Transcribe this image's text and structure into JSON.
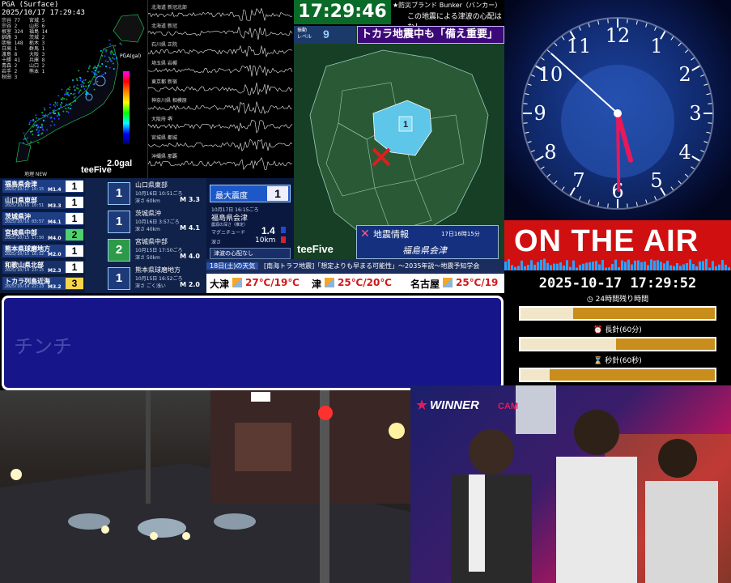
{
  "pga_panel": {
    "title": "PGA (Surface)",
    "timestamp": "2025/10/17 17:29:43",
    "gal_label": "2.0gal",
    "logo": "teeFive",
    "small_label": "PGA(gal)",
    "footer_label": "地理 NEW",
    "stations": [
      "宗谷 77",
      "宗谷 2",
      "根室 324",
      "釧路 3",
      "胆振 148",
      "日高 1",
      "渡島 8",
      "十勝 41",
      "青森 2",
      "岩手 2",
      "秋田 3",
      "宮城 5",
      "山形 6",
      "福島 14",
      "茨城 2",
      "栃木 3",
      "群馬 1",
      "大阪 3",
      "兵庫 8",
      "山口 2",
      "熊本 1"
    ]
  },
  "waveform_panel": {
    "labels": [
      "北海道 新冠北部",
      "北海道 新冠",
      "石川県 正院",
      "埼玉県 岩槻",
      "東京都 新宿",
      "神奈川県 相模原",
      "大阪府 堺",
      "宮城県 都城",
      "沖縄県 那覇"
    ]
  },
  "quake_list": [
    {
      "name": "福島県会津",
      "time": "2025/10/17 16:15",
      "mag": "M1.4",
      "intensity": "1",
      "color": "#ffffff"
    },
    {
      "name": "山口県東部",
      "time": "2025/10/16 10:51",
      "mag": "M3.3",
      "intensity": "1",
      "color": "#ffffff"
    },
    {
      "name": "茨城県沖",
      "time": "2025/10/16 03:57",
      "mag": "M4.1",
      "intensity": "1",
      "color": "#ffffff"
    },
    {
      "name": "宮城県中部",
      "time": "2025/10/15 17:50",
      "mag": "M4.0",
      "intensity": "2",
      "color": "#4fd16c"
    },
    {
      "name": "熊本県球磨地方",
      "time": "2025/10/15 16:52",
      "mag": "M2.0",
      "intensity": "1",
      "color": "#ffffff"
    },
    {
      "name": "和歌山県北部",
      "time": "2025/10/14 23:15",
      "mag": "M2.3",
      "intensity": "1",
      "color": "#ffffff"
    },
    {
      "name": "トカラ列島近海",
      "time": "2025/10/14 22:23",
      "mag": "M3.2",
      "intensity": "3",
      "color": "#f7d44a"
    }
  ],
  "quake_detail": [
    {
      "intensity": "1",
      "place": "山口県東部",
      "time": "10月16日 10:51ごろ",
      "depth": "深さ 60km",
      "mag": "M 3.3"
    },
    {
      "intensity": "1",
      "place": "茨城県沖",
      "time": "10月16日 3:57ごろ",
      "depth": "深さ 40km",
      "mag": "M 4.1"
    },
    {
      "intensity": "2",
      "place": "宮城県中部",
      "time": "10月15日 17:50ごろ",
      "depth": "深さ 50km",
      "mag": "M 4.0"
    },
    {
      "intensity": "1",
      "place": "熊本県球磨地方",
      "time": "10月15日 16:52ごろ",
      "depth": "深さ ごく浅い",
      "mag": "M 2.0"
    }
  ],
  "max_intensity": {
    "label": "最大震度",
    "value": "1",
    "date": "10月17日 16:15ごろ",
    "place": "福島県会津",
    "sub": "震源の深さ（推定）",
    "mag_label": "マグニチュード",
    "mag_value": "1.4",
    "depth_label": "深さ",
    "depth_value": "10km",
    "tsunami": "津波の心配なし"
  },
  "clock_bar": {
    "time": "17:29:46",
    "news_head": "★防災ブランド Bunker（バンカー）",
    "news_sub": "この地震による津波の心配はなし"
  },
  "quake_map": {
    "level_label": "振動\nレベル",
    "level_value": "9",
    "headline": "トカラ地震中も「備え重要」",
    "region_intensity": "1",
    "logo": "teeFive",
    "info_title": "地震情報",
    "info_time": "17日16時15分",
    "info_place": "福島県会津"
  },
  "weather": {
    "ticker_date": "18日(土)の天気",
    "ticker_text": "[南海トラフ地震]「想定よりも早まる可能性」～2035年説～地震予知学会",
    "cities": [
      {
        "name": "大津",
        "temp": "27℃/19℃"
      },
      {
        "name": "津",
        "temp": "25℃/20℃"
      },
      {
        "name": "名古屋",
        "temp": "25℃/19"
      }
    ]
  },
  "textbox": {
    "text": "チンチ"
  },
  "analog_clock": {
    "hour": 5,
    "minute": 29,
    "second": 52
  },
  "on_air": {
    "label": "ON THE AIR"
  },
  "datetime": "2025-10-17 17:29:52",
  "progress": [
    {
      "label": "24時間残り時間",
      "fraction": 0.27,
      "icon": "clock-icon"
    },
    {
      "label": "長針(60分)",
      "fraction": 0.49,
      "icon": "alarm-icon"
    },
    {
      "label": "秒針(60秒)",
      "fraction": 0.15,
      "icon": "hourglass-icon"
    }
  ],
  "winner_cam": {
    "logo": "WINNER",
    "cam": "CAM"
  },
  "colors": {
    "onair": "#d01010",
    "clock_green": "#0a6a28",
    "textbox": "#16168a",
    "progress_track": "#c88d1a"
  }
}
